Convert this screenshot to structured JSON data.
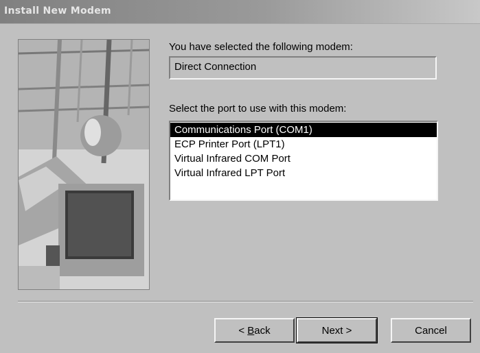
{
  "window": {
    "title": "Install New Modem"
  },
  "modem": {
    "selected_label": "You have selected the following modem:",
    "selected_value": "Direct Connection"
  },
  "port": {
    "label": "Select the port to use with this modem:",
    "options": [
      "Communications Port (COM1)",
      "ECP Printer Port (LPT1)",
      "Virtual Infrared COM Port",
      "Virtual Infrared LPT Port"
    ],
    "selected_index": 0
  },
  "buttons": {
    "back_prefix": "< ",
    "back_accel": "B",
    "back_rest": "ack",
    "next": "Next >",
    "cancel": "Cancel"
  }
}
